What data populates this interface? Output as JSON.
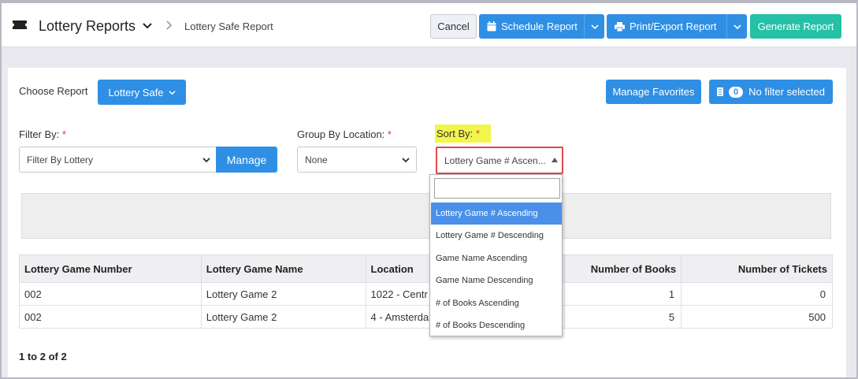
{
  "header": {
    "title": "Lottery Reports",
    "breadcrumb": "Lottery Safe Report",
    "cancel_label": "Cancel",
    "schedule_label": "Schedule Report",
    "print_label": "Print/Export Report",
    "generate_label": "Generate Report"
  },
  "toolbar": {
    "choose_report_label": "Choose Report",
    "report_select_label": "Lottery Safe",
    "manage_favorites_label": "Manage Favorites",
    "filter_count": "0",
    "filter_status": "No filter selected"
  },
  "filters": {
    "filter_by_label": "Filter By:",
    "filter_by_value": "Filter By Lottery",
    "manage_label": "Manage",
    "group_by_label": "Group By Location:",
    "group_by_value": "None",
    "sort_by_label": "Sort By:",
    "sort_by_value": "Lottery Game # Ascen...",
    "required_mark": "*"
  },
  "sort_dropdown": {
    "options": [
      "Lottery Game # Ascending",
      "Lottery Game # Descending",
      "Game Name Ascending",
      "Game Name Descending",
      "# of Books Ascending",
      "# of Books Descending"
    ],
    "selected_index": 0
  },
  "table": {
    "columns": [
      "Lottery Game Number",
      "Lottery Game Name",
      "Location",
      "Number of Books",
      "Number of Tickets"
    ],
    "rows": [
      [
        "002",
        "Lottery Game 2",
        "1022 - Centr",
        "1",
        "0"
      ],
      [
        "002",
        "Lottery Game 2",
        "4 - Amsterda",
        "5",
        "500"
      ]
    ]
  },
  "pager": "1 to 2 of 2",
  "colors": {
    "primary": "#2f8fe4",
    "teal": "#25c1a6",
    "highlight": "#f2f54c",
    "required": "#e0333a"
  }
}
